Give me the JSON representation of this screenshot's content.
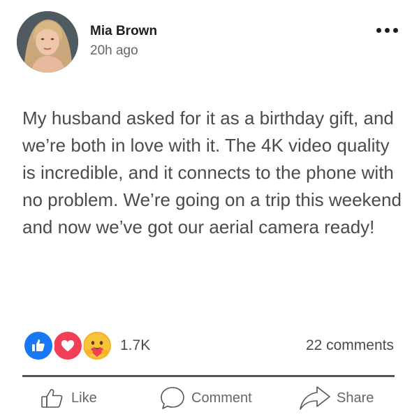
{
  "post": {
    "author": "Mia Brown",
    "time": "20h ago",
    "text": "My husband asked for it as a birthday gift, and we’re both in love with it. The 4K video quality is incredible, and it connects to the phone with no problem. We’re going on a trip this weekend and now we’ve got our aerial camera ready!"
  },
  "reactions": {
    "icons": [
      "like-icon",
      "love-icon",
      "care-icon"
    ],
    "count": "1.7K",
    "comments": "22 comments"
  },
  "actions": {
    "like": "Like",
    "comment": "Comment",
    "share": "Share"
  },
  "colors": {
    "like": "#1877f2",
    "love": "#f33e58",
    "care": "#f7b125"
  }
}
